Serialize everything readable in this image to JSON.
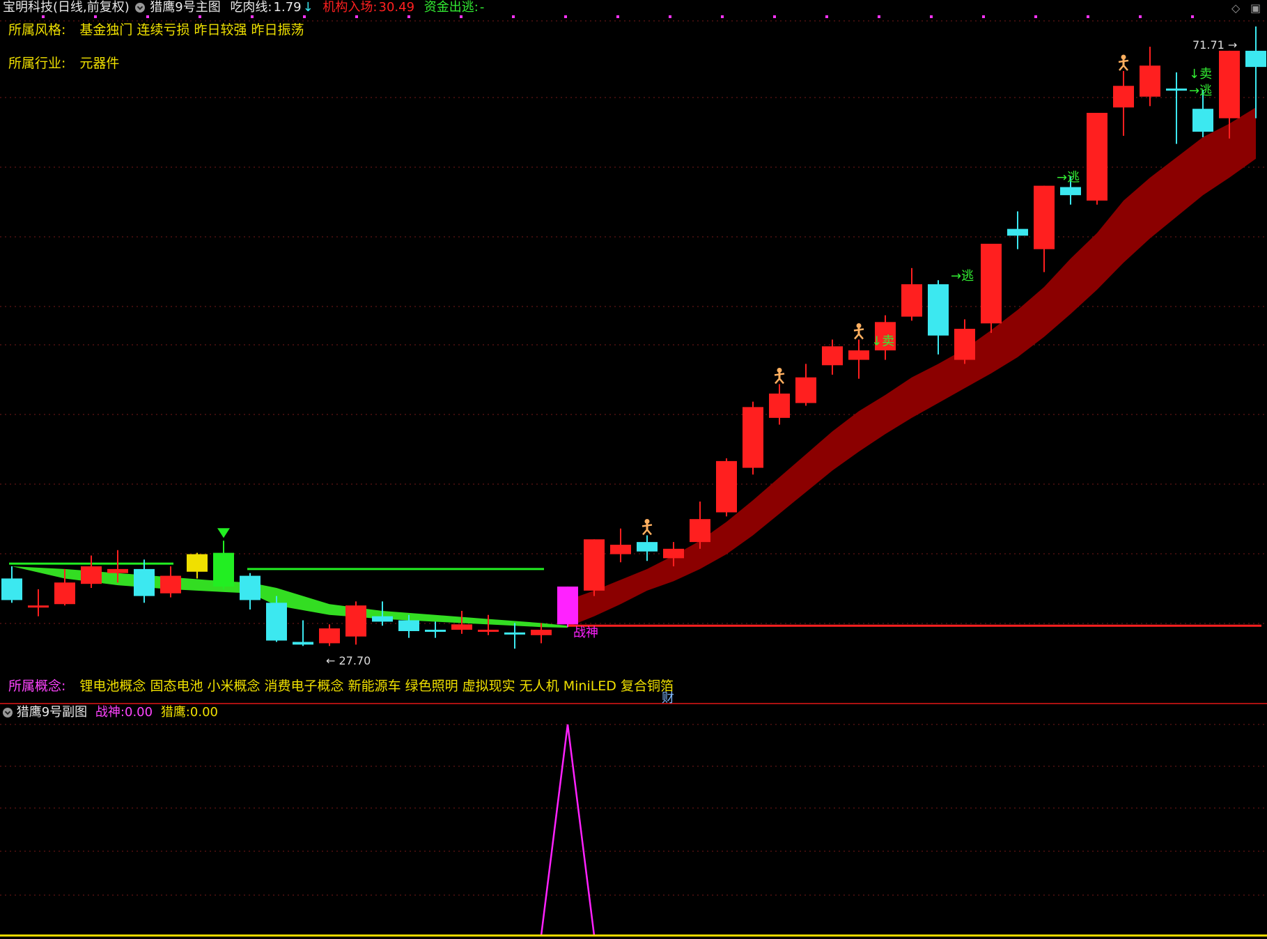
{
  "header": {
    "title": "宝明科技(日线,前复权)",
    "indicator": "猎鹰9号主图",
    "line1_label": "吃肉线:",
    "line1_value": "1.79",
    "line1_arrow": "↓",
    "line2_label": "机构入场:",
    "line2_value": "30.49",
    "line3_label": "资金出逃:",
    "line3_value": "-"
  },
  "info": {
    "style_label": "所属风格:",
    "style_value": "基金独门 连续亏损 昨日较强 昨日振荡",
    "industry_label": "所属行业:",
    "industry_value": "元器件",
    "concept_label": "所属概念:",
    "concept_value": "锂电池概念 固态电池 小米概念 消费电子概念 新能源车 绿色照明 虚拟现实 无人机 MiniLED 复合铜箔"
  },
  "cai_label": "财",
  "sub": {
    "title": "猎鹰9号副图",
    "l1_label": "战神:",
    "l1_value": "0.00",
    "l2_label": "猎鹰:",
    "l2_value": "0.00"
  },
  "colors": {
    "up": "#ff1f1f",
    "down": "#3ce8f0",
    "band": "#8b0000",
    "green_band": "#33dd22",
    "magenta": "#ff22ff",
    "yellow": "#f0e000",
    "grid": "#7a1a1a"
  },
  "chart_data": {
    "type": "candlestick",
    "price_range": [
      25.5,
      73.5
    ],
    "high_label": "71.71",
    "low_label": "27.70",
    "candles": [
      {
        "o": 31.0,
        "c": 32.6,
        "h": 33.5,
        "l": 30.8,
        "col": "down"
      },
      {
        "o": 30.5,
        "c": 30.6,
        "h": 31.8,
        "l": 29.8,
        "col": "cross_red"
      },
      {
        "o": 30.7,
        "c": 32.3,
        "h": 33.3,
        "l": 30.6,
        "col": "up"
      },
      {
        "o": 32.2,
        "c": 33.5,
        "h": 34.3,
        "l": 31.9,
        "col": "up"
      },
      {
        "o": 33.0,
        "c": 33.3,
        "h": 34.7,
        "l": 32.3,
        "col": "up"
      },
      {
        "o": 33.3,
        "c": 31.3,
        "h": 34.0,
        "l": 30.8,
        "col": "down"
      },
      {
        "o": 31.5,
        "c": 32.8,
        "h": 33.5,
        "l": 31.2,
        "col": "up"
      },
      {
        "o": 33.1,
        "c": 34.4,
        "h": 34.5,
        "l": 32.6,
        "col": "yellow"
      },
      {
        "o": 32.0,
        "c": 34.5,
        "h": 35.4,
        "l": 31.8,
        "col": "green"
      },
      {
        "o": 32.8,
        "c": 31.0,
        "h": 33.0,
        "l": 30.3,
        "col": "down"
      },
      {
        "o": 30.8,
        "c": 28.0,
        "h": 31.3,
        "l": 27.9,
        "col": "down"
      },
      {
        "o": 27.9,
        "c": 27.7,
        "h": 29.5,
        "l": 27.6,
        "col": "down"
      },
      {
        "o": 27.8,
        "c": 28.9,
        "h": 29.2,
        "l": 27.6,
        "col": "up"
      },
      {
        "o": 28.3,
        "c": 30.6,
        "h": 30.9,
        "l": 27.7,
        "col": "up"
      },
      {
        "o": 29.8,
        "c": 29.4,
        "h": 30.9,
        "l": 29.1,
        "col": "down"
      },
      {
        "o": 29.5,
        "c": 28.7,
        "h": 29.9,
        "l": 28.2,
        "col": "down"
      },
      {
        "o": 28.8,
        "c": 28.7,
        "h": 29.4,
        "l": 28.2,
        "col": "cross_cyan"
      },
      {
        "o": 28.8,
        "c": 29.2,
        "h": 30.2,
        "l": 28.5,
        "col": "up"
      },
      {
        "o": 28.7,
        "c": 28.8,
        "h": 29.9,
        "l": 28.4,
        "col": "cross_red"
      },
      {
        "o": 28.6,
        "c": 28.5,
        "h": 29.3,
        "l": 27.4,
        "col": "cross_cyan"
      },
      {
        "o": 28.4,
        "c": 28.8,
        "h": 29.3,
        "l": 27.8,
        "col": "up"
      },
      {
        "o": 29.2,
        "c": 32.0,
        "h": 32.0,
        "l": 29.0,
        "col": "magenta"
      },
      {
        "o": 31.7,
        "c": 35.5,
        "h": 35.5,
        "l": 31.3,
        "col": "up"
      },
      {
        "o": 34.4,
        "c": 35.1,
        "h": 36.3,
        "l": 33.8,
        "col": "up"
      },
      {
        "o": 35.3,
        "c": 34.6,
        "h": 35.8,
        "l": 33.9,
        "col": "down"
      },
      {
        "o": 34.1,
        "c": 34.8,
        "h": 35.3,
        "l": 33.5,
        "col": "up"
      },
      {
        "o": 35.3,
        "c": 37.0,
        "h": 38.3,
        "l": 34.8,
        "col": "up"
      },
      {
        "o": 37.5,
        "c": 41.3,
        "h": 41.5,
        "l": 37.2,
        "col": "up"
      },
      {
        "o": 40.8,
        "c": 45.3,
        "h": 45.7,
        "l": 40.3,
        "col": "up"
      },
      {
        "o": 44.5,
        "c": 46.3,
        "h": 47.0,
        "l": 44.0,
        "col": "up"
      },
      {
        "o": 45.6,
        "c": 47.5,
        "h": 48.5,
        "l": 45.4,
        "col": "up"
      },
      {
        "o": 48.4,
        "c": 49.8,
        "h": 50.3,
        "l": 47.7,
        "col": "up"
      },
      {
        "o": 48.8,
        "c": 49.5,
        "h": 50.3,
        "l": 47.4,
        "col": "up"
      },
      {
        "o": 49.5,
        "c": 51.6,
        "h": 52.1,
        "l": 48.8,
        "col": "up"
      },
      {
        "o": 52.0,
        "c": 54.4,
        "h": 55.6,
        "l": 51.7,
        "col": "up"
      },
      {
        "o": 54.4,
        "c": 50.6,
        "h": 54.7,
        "l": 49.2,
        "col": "down"
      },
      {
        "o": 48.8,
        "c": 51.1,
        "h": 51.8,
        "l": 48.5,
        "col": "up"
      },
      {
        "o": 51.5,
        "c": 57.4,
        "h": 57.4,
        "l": 50.8,
        "col": "up"
      },
      {
        "o": 58.5,
        "c": 58.0,
        "h": 59.8,
        "l": 57.0,
        "col": "down"
      },
      {
        "o": 57.0,
        "c": 61.7,
        "h": 61.7,
        "l": 55.3,
        "col": "up"
      },
      {
        "o": 61.0,
        "c": 61.6,
        "h": 62.4,
        "l": 60.3,
        "col": "down"
      },
      {
        "o": 60.6,
        "c": 67.1,
        "h": 67.1,
        "l": 60.3,
        "col": "up"
      },
      {
        "o": 67.5,
        "c": 69.1,
        "h": 70.2,
        "l": 65.4,
        "col": "up"
      },
      {
        "o": 68.3,
        "c": 70.6,
        "h": 72.0,
        "l": 67.6,
        "col": "up"
      },
      {
        "o": 68.8,
        "c": 68.9,
        "h": 70.1,
        "l": 64.8,
        "col": "cross_cyan"
      },
      {
        "o": 67.4,
        "c": 65.7,
        "h": 68.8,
        "l": 65.3,
        "col": "down"
      },
      {
        "o": 66.7,
        "c": 71.7,
        "h": 71.7,
        "l": 65.2,
        "col": "up"
      },
      {
        "o": 71.7,
        "c": 70.5,
        "h": 73.5,
        "l": 66.7,
        "col": "down"
      }
    ],
    "band_upper": [
      [
        21,
        31.0
      ],
      [
        22,
        31.7
      ],
      [
        23,
        32.5
      ],
      [
        24,
        33.3
      ],
      [
        25,
        34.3
      ],
      [
        26,
        35.4
      ],
      [
        27,
        36.8
      ],
      [
        28,
        38.4
      ],
      [
        29,
        40.1
      ],
      [
        30,
        41.8
      ],
      [
        31,
        43.5
      ],
      [
        32,
        45.0
      ],
      [
        33,
        46.2
      ],
      [
        34,
        47.5
      ],
      [
        35,
        48.5
      ],
      [
        36,
        49.6
      ],
      [
        37,
        51.0
      ],
      [
        38,
        52.5
      ],
      [
        39,
        54.2
      ],
      [
        40,
        56.3
      ],
      [
        41,
        58.2
      ],
      [
        42,
        60.6
      ],
      [
        43,
        62.3
      ],
      [
        44,
        63.8
      ],
      [
        45,
        65.3
      ],
      [
        46,
        66.3
      ],
      [
        47,
        67.5
      ]
    ],
    "band_lower": [
      [
        21,
        29.0
      ],
      [
        22,
        29.8
      ],
      [
        23,
        30.7
      ],
      [
        24,
        31.7
      ],
      [
        25,
        32.4
      ],
      [
        26,
        33.3
      ],
      [
        27,
        34.4
      ],
      [
        28,
        35.8
      ],
      [
        29,
        37.4
      ],
      [
        30,
        39.0
      ],
      [
        31,
        40.6
      ],
      [
        32,
        42.0
      ],
      [
        33,
        43.3
      ],
      [
        34,
        44.5
      ],
      [
        35,
        45.6
      ],
      [
        36,
        46.7
      ],
      [
        37,
        47.8
      ],
      [
        38,
        49.0
      ],
      [
        39,
        50.5
      ],
      [
        40,
        52.2
      ],
      [
        41,
        54.0
      ],
      [
        42,
        56.0
      ],
      [
        43,
        57.8
      ],
      [
        44,
        59.4
      ],
      [
        45,
        61.0
      ],
      [
        46,
        62.3
      ],
      [
        47,
        63.7
      ]
    ],
    "green_upper": [
      [
        0,
        33.5
      ],
      [
        2,
        32.6
      ],
      [
        4,
        32.1
      ],
      [
        6,
        31.8
      ],
      [
        8,
        31.6
      ],
      [
        9,
        31.5
      ],
      [
        10,
        30.6
      ],
      [
        12,
        29.9
      ],
      [
        14,
        29.6
      ],
      [
        16,
        29.4
      ],
      [
        18,
        29.2
      ],
      [
        20,
        29.0
      ],
      [
        21,
        28.95
      ]
    ],
    "green_lower": [
      [
        0,
        33.5
      ],
      [
        2,
        33.3
      ],
      [
        4,
        33.0
      ],
      [
        6,
        32.7
      ],
      [
        8,
        32.4
      ],
      [
        9,
        32.3
      ],
      [
        10,
        31.9
      ],
      [
        12,
        30.7
      ],
      [
        14,
        30.2
      ],
      [
        16,
        29.9
      ],
      [
        18,
        29.6
      ],
      [
        20,
        29.3
      ],
      [
        21,
        29.1
      ]
    ],
    "green_lines": [
      {
        "from": 0,
        "to": 6,
        "y": 33.7
      },
      {
        "from": 9,
        "to": 20,
        "y": 33.3
      }
    ],
    "red_line": {
      "from": 21,
      "to": 47,
      "y": 29.1
    },
    "markers": [
      {
        "i": 8,
        "type": "triangle"
      },
      {
        "i": 24,
        "type": "man"
      },
      {
        "i": 29,
        "type": "man"
      },
      {
        "i": 32,
        "type": "man"
      },
      {
        "i": 42,
        "type": "man"
      }
    ],
    "texts": [
      {
        "i": 32,
        "text": "↓卖",
        "color": "#33ee33"
      },
      {
        "i": 35,
        "text": "→逃",
        "color": "#33ee33"
      },
      {
        "i": 39,
        "text": "→逃",
        "color": "#33ee33"
      },
      {
        "i": 44,
        "text": "↓卖",
        "color": "#33ee33"
      },
      {
        "i": 44,
        "text": "→逃",
        "color": "#33ee33"
      },
      {
        "i": 21,
        "text": "战神",
        "color": "#ff22ff"
      }
    ],
    "sub_series": {
      "name": "战神",
      "values_nonzero": [
        {
          "i": 21,
          "v": 1
        }
      ]
    }
  }
}
